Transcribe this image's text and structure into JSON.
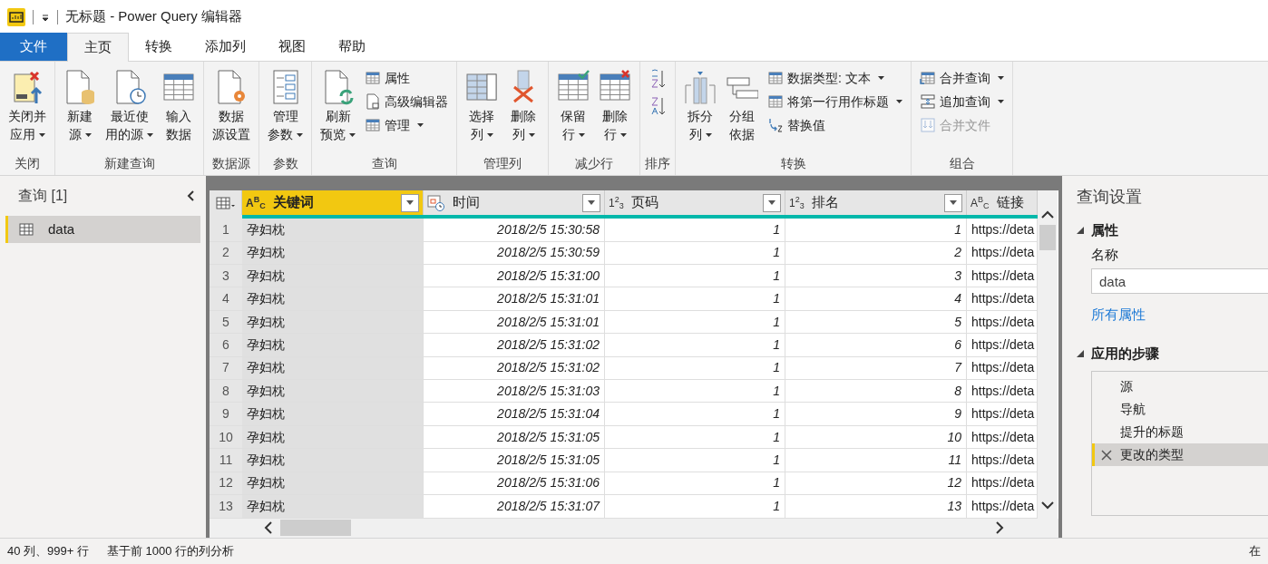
{
  "title_bar": {
    "title": "无标题 - Power Query 编辑器"
  },
  "menu_tabs": [
    {
      "label": "文件",
      "kind": "file",
      "selected": false
    },
    {
      "label": "主页",
      "kind": "tab",
      "selected": true
    },
    {
      "label": "转换",
      "kind": "tab",
      "selected": false
    },
    {
      "label": "添加列",
      "kind": "tab",
      "selected": false
    },
    {
      "label": "视图",
      "kind": "tab",
      "selected": false
    },
    {
      "label": "帮助",
      "kind": "tab",
      "selected": false
    }
  ],
  "ribbon_groups": [
    {
      "label": "关闭",
      "items": [
        {
          "kind": "large",
          "lines": [
            "关闭并",
            "应用"
          ],
          "dropdown": true
        }
      ]
    },
    {
      "label": "新建查询",
      "items": [
        {
          "kind": "large",
          "lines": [
            "新建",
            "源"
          ],
          "dropdown": true
        },
        {
          "kind": "large",
          "lines": [
            "最近使",
            "用的源"
          ],
          "dropdown": true
        },
        {
          "kind": "large",
          "lines": [
            "输入",
            "数据"
          ],
          "dropdown": false
        }
      ]
    },
    {
      "label": "数据源",
      "items": [
        {
          "kind": "large",
          "lines": [
            "数据",
            "源设置"
          ],
          "dropdown": false
        }
      ]
    },
    {
      "label": "参数",
      "items": [
        {
          "kind": "large",
          "lines": [
            "管理",
            "参数"
          ],
          "dropdown": true
        }
      ]
    },
    {
      "label": "查询",
      "items": [
        {
          "kind": "large",
          "lines": [
            "刷新",
            "预览"
          ],
          "dropdown": true
        },
        {
          "kind": "stack",
          "items": [
            {
              "label": "属性",
              "dropdown": false,
              "disabled": false
            },
            {
              "label": "高级编辑器",
              "dropdown": false,
              "disabled": false
            },
            {
              "label": "管理",
              "dropdown": true,
              "disabled": false
            }
          ]
        }
      ]
    },
    {
      "label": "管理列",
      "items": [
        {
          "kind": "large",
          "lines": [
            "选择",
            "列"
          ],
          "dropdown": true
        },
        {
          "kind": "large",
          "lines": [
            "删除",
            "列"
          ],
          "dropdown": true
        }
      ]
    },
    {
      "label": "减少行",
      "items": [
        {
          "kind": "large",
          "lines": [
            "保留",
            "行"
          ],
          "dropdown": true
        },
        {
          "kind": "large",
          "lines": [
            "删除",
            "行"
          ],
          "dropdown": true
        }
      ]
    },
    {
      "label": "排序",
      "items": [
        {
          "kind": "sort"
        }
      ]
    },
    {
      "label": "转换",
      "items": [
        {
          "kind": "large",
          "lines": [
            "拆分",
            "列"
          ],
          "dropdown": true
        },
        {
          "kind": "large",
          "lines": [
            "分组",
            "依据"
          ],
          "dropdown": false
        },
        {
          "kind": "stack",
          "items": [
            {
              "label": "数据类型: 文本",
              "dropdown": true,
              "disabled": false
            },
            {
              "label": "将第一行用作标题",
              "dropdown": true,
              "disabled": false
            },
            {
              "label": "替换值",
              "dropdown": false,
              "disabled": false
            }
          ]
        }
      ]
    },
    {
      "label": "组合",
      "items": [
        {
          "kind": "stack",
          "items": [
            {
              "label": "合并查询",
              "dropdown": true,
              "disabled": false
            },
            {
              "label": "追加查询",
              "dropdown": true,
              "disabled": false
            },
            {
              "label": "合并文件",
              "dropdown": false,
              "disabled": true
            }
          ]
        }
      ]
    }
  ],
  "queries_pane": {
    "title": "查询 [1]",
    "items": [
      {
        "label": "data",
        "selected": true
      }
    ]
  },
  "grid": {
    "columns": [
      {
        "name": "关键词",
        "kind": "text",
        "type_mark": "A$^{B}$$_{C}$",
        "selected": true
      },
      {
        "name": "时间",
        "kind": "datetime",
        "selected": false
      },
      {
        "name": "页码",
        "kind": "number",
        "type_mark": "1$^{2}$$_{3}$",
        "selected": false
      },
      {
        "name": "排名",
        "kind": "number",
        "type_mark": "1$^{2}$$_{3}$",
        "selected": false
      },
      {
        "name": "链接",
        "kind": "text",
        "type_mark": "A$^{B}$$_{C}$",
        "selected": false
      }
    ],
    "rows": [
      {
        "num": "1",
        "cells": [
          "孕妇枕",
          "2018/2/5 15:30:58",
          "1",
          "1",
          "https://deta"
        ]
      },
      {
        "num": "2",
        "cells": [
          "孕妇枕",
          "2018/2/5 15:30:59",
          "1",
          "2",
          "https://deta"
        ]
      },
      {
        "num": "3",
        "cells": [
          "孕妇枕",
          "2018/2/5 15:31:00",
          "1",
          "3",
          "https://deta"
        ]
      },
      {
        "num": "4",
        "cells": [
          "孕妇枕",
          "2018/2/5 15:31:01",
          "1",
          "4",
          "https://deta"
        ]
      },
      {
        "num": "5",
        "cells": [
          "孕妇枕",
          "2018/2/5 15:31:01",
          "1",
          "5",
          "https://deta"
        ]
      },
      {
        "num": "6",
        "cells": [
          "孕妇枕",
          "2018/2/5 15:31:02",
          "1",
          "6",
          "https://deta"
        ]
      },
      {
        "num": "7",
        "cells": [
          "孕妇枕",
          "2018/2/5 15:31:02",
          "1",
          "7",
          "https://deta"
        ]
      },
      {
        "num": "8",
        "cells": [
          "孕妇枕",
          "2018/2/5 15:31:03",
          "1",
          "8",
          "https://deta"
        ]
      },
      {
        "num": "9",
        "cells": [
          "孕妇枕",
          "2018/2/5 15:31:04",
          "1",
          "9",
          "https://deta"
        ]
      },
      {
        "num": "10",
        "cells": [
          "孕妇枕",
          "2018/2/5 15:31:05",
          "1",
          "10",
          "https://deta"
        ]
      },
      {
        "num": "11",
        "cells": [
          "孕妇枕",
          "2018/2/5 15:31:05",
          "1",
          "11",
          "https://deta"
        ]
      },
      {
        "num": "12",
        "cells": [
          "孕妇枕",
          "2018/2/5 15:31:06",
          "1",
          "12",
          "https://deta"
        ]
      },
      {
        "num": "13",
        "cells": [
          "孕妇枕",
          "2018/2/5 15:31:07",
          "1",
          "13",
          "https://deta"
        ]
      }
    ]
  },
  "settings_pane": {
    "title": "查询设置",
    "properties": {
      "title": "属性",
      "expanded": true,
      "name_label": "名称",
      "name_value": "data",
      "link": "所有属性"
    },
    "steps": {
      "title": "应用的步骤",
      "expanded": true,
      "items": [
        {
          "label": "源",
          "selected": false
        },
        {
          "label": "导航",
          "selected": false
        },
        {
          "label": "提升的标题",
          "selected": false
        },
        {
          "label": "更改的类型",
          "selected": true
        }
      ]
    }
  },
  "status_bar": {
    "left": [
      "40 列、999+ 行",
      "基于前 1000 行的列分析"
    ],
    "right": "在"
  }
}
